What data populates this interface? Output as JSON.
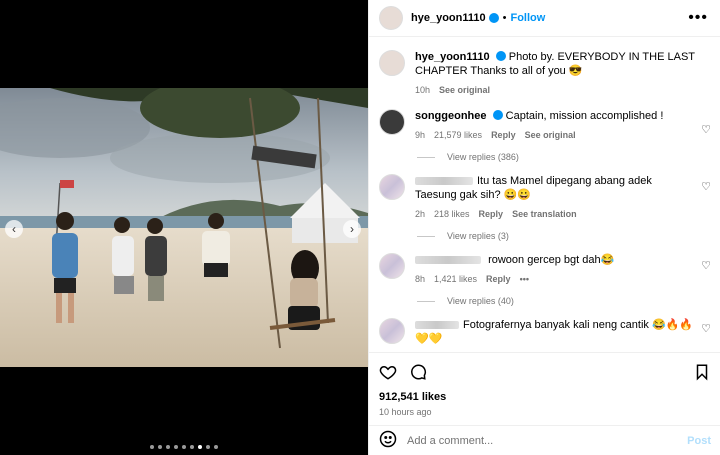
{
  "post": {
    "username": "hye_yoon1110",
    "follow_label": "Follow",
    "more_label": "•••",
    "caption": "Photo by. EVERYBODY IN THE LAST CHAPTER Thanks to all of you 😎",
    "caption_time": "10h",
    "see_original": "See original",
    "likes": "912,541 likes",
    "posted": "10 hours ago",
    "image_slide": 7,
    "image_count": 9
  },
  "comments": [
    {
      "user": "songgeonhee",
      "text": "Captain, mission accomplished !",
      "time": "9h",
      "likes": "21,579 likes",
      "reply": "Reply",
      "extra": "See original",
      "view_replies": "View replies (386)"
    },
    {
      "user": "",
      "text": "Itu tas Mamel dipegang abang adek Taesung gak sih? 😀😀",
      "time": "2h",
      "likes": "218 likes",
      "reply": "Reply",
      "extra": "See translation",
      "view_replies": "View replies (3)"
    },
    {
      "user": "",
      "text": "rowoon gercep bgt dah😂",
      "time": "8h",
      "likes": "1,421 likes",
      "reply": "Reply",
      "extra": "•••",
      "view_replies": "View replies (40)"
    },
    {
      "user": "",
      "text": "Fotografernya banyak kali neng cantik 😂🔥🔥💛💛"
    }
  ],
  "compose": {
    "placeholder": "Add a comment...",
    "post_label": "Post"
  },
  "icons": [
    "heart-icon",
    "comment-icon",
    "bookmark-icon",
    "emoji-icon",
    "chevron-left-icon",
    "chevron-right-icon"
  ],
  "colors": {
    "link": "#0095f6",
    "muted": "#737373",
    "post_disabled": "#b2dffc"
  }
}
